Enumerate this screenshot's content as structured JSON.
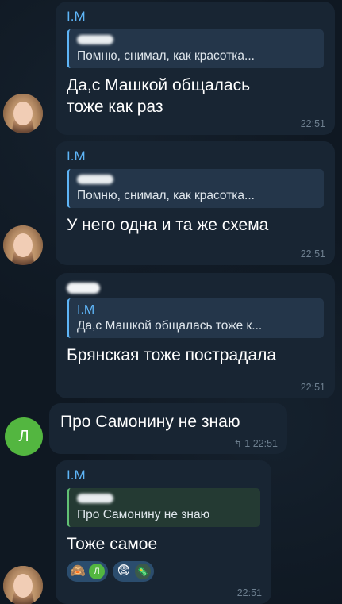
{
  "messages": [
    {
      "sender": "I.M",
      "reply_text": "Помню, снимал, как красотка...",
      "text_line1": "Да,с Машкой общалась",
      "text_line2": "тоже как раз",
      "time": "22:51"
    },
    {
      "sender": "I.M",
      "reply_text": "Помню, снимал, как красотка...",
      "text": "У него одна и та же схема",
      "time": "22:51"
    },
    {
      "reply_name": "I.M",
      "reply_text": "Да,с Машкой общалась тоже к...",
      "text": "Брянская тоже пострадала",
      "time": "22:51"
    },
    {
      "avatar_letter": "Л",
      "text": "Про Самонину не знаю",
      "reply_icon": "↰",
      "reply_count": "1",
      "time": "22:51"
    },
    {
      "sender": "I.M",
      "reply_text": "Про Самонину не знаю",
      "text": "Тоже самое",
      "time": "22:51",
      "reactions": [
        {
          "emoji": "🙈",
          "user_letter": "Л"
        },
        {
          "emoji": "😨",
          "user_icon": "🦠"
        }
      ]
    }
  ],
  "colors": {
    "background": "#0e1621",
    "bubble": "#182533",
    "accent_blue": "#5eb5f7",
    "accent_green": "#61c175",
    "avatar_green": "#53b640",
    "time": "#6d7f8f"
  }
}
